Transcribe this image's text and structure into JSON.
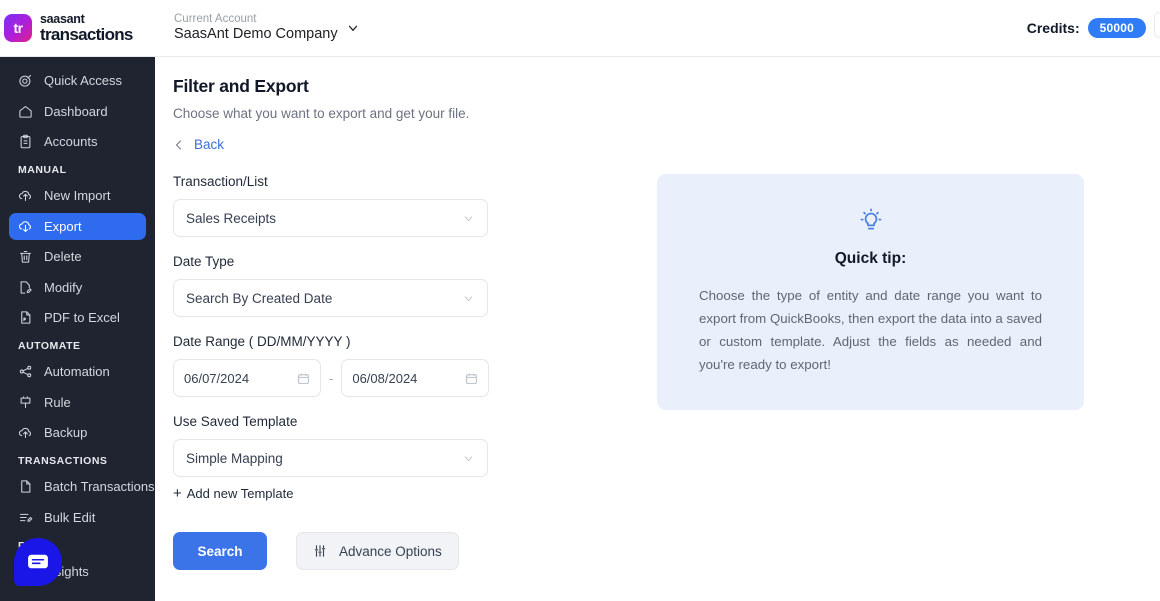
{
  "brand": {
    "mark": "tr",
    "name_top": "saasant",
    "name_bottom": "transactions"
  },
  "topbar": {
    "account_label": "Current Account",
    "account_name": "SaasAnt Demo Company",
    "credits_label": "Credits:",
    "credits_value": "50000",
    "accent_blue": "#2f7cf6"
  },
  "sidebar": {
    "items": [
      {
        "label": "Quick Access",
        "icon": "target-icon",
        "active": false
      },
      {
        "label": "Dashboard",
        "icon": "home-icon",
        "active": false
      },
      {
        "label": "Accounts",
        "icon": "clipboard-icon",
        "active": false
      }
    ],
    "sections": [
      {
        "title": "MANUAL",
        "items": [
          {
            "label": "New Import",
            "icon": "upload-cloud-icon",
            "active": false
          },
          {
            "label": "Export",
            "icon": "download-cloud-icon",
            "active": true
          },
          {
            "label": "Delete",
            "icon": "trash-icon",
            "active": false
          },
          {
            "label": "Modify",
            "icon": "file-edit-icon",
            "active": false
          },
          {
            "label": "PDF to Excel",
            "icon": "pdf-file-icon",
            "active": false
          }
        ]
      },
      {
        "title": "AUTOMATE",
        "items": [
          {
            "label": "Automation",
            "icon": "share-nodes-icon",
            "active": false
          },
          {
            "label": "Rule",
            "icon": "rule-flag-icon",
            "active": false
          },
          {
            "label": "Backup",
            "icon": "backup-cloud-icon",
            "active": false
          }
        ]
      },
      {
        "title": "TRANSACTIONS",
        "items": [
          {
            "label": "Batch Transactions",
            "icon": "document-icon",
            "active": false
          },
          {
            "label": "Bulk Edit",
            "icon": "list-edit-icon",
            "active": false
          }
        ]
      },
      {
        "title": "R",
        "items": [
          {
            "label": "Insights",
            "icon": "sliders-icon",
            "active": false
          }
        ]
      }
    ],
    "active_color": "#2f6bee",
    "background": "#1f2430"
  },
  "chat": {
    "icon": "chat-bubble-icon",
    "color": "#1a16e8"
  },
  "main": {
    "title": "Filter and Export",
    "subtitle": "Choose what you want to export and get your file.",
    "back_label": "Back",
    "back_icon": "chevron-left-icon",
    "fields": {
      "transaction_list": {
        "label": "Transaction/List",
        "value": "Sales Receipts"
      },
      "date_type": {
        "label": "Date Type",
        "value": "Search By Created Date"
      },
      "date_range": {
        "label": "Date Range ( DD/MM/YYYY )",
        "from": "06/07/2024",
        "to": "06/08/2024",
        "separator": "-"
      },
      "saved_template": {
        "label": "Use Saved Template",
        "value": "Simple Mapping"
      }
    },
    "add_template_label": "Add new Template",
    "add_template_plus": "+",
    "buttons": {
      "search": "Search",
      "advance_options": "Advance Options",
      "advance_icon": "sliders-icon",
      "search_color": "#3b74e8"
    }
  },
  "tip": {
    "icon": "lightbulb-icon",
    "title": "Quick tip:",
    "body": "Choose the type of entity and date range you want to export from QuickBooks, then export the data into a saved or custom template. Adjust the fields as needed and you're ready to export!",
    "background": "#eaf0fb"
  }
}
